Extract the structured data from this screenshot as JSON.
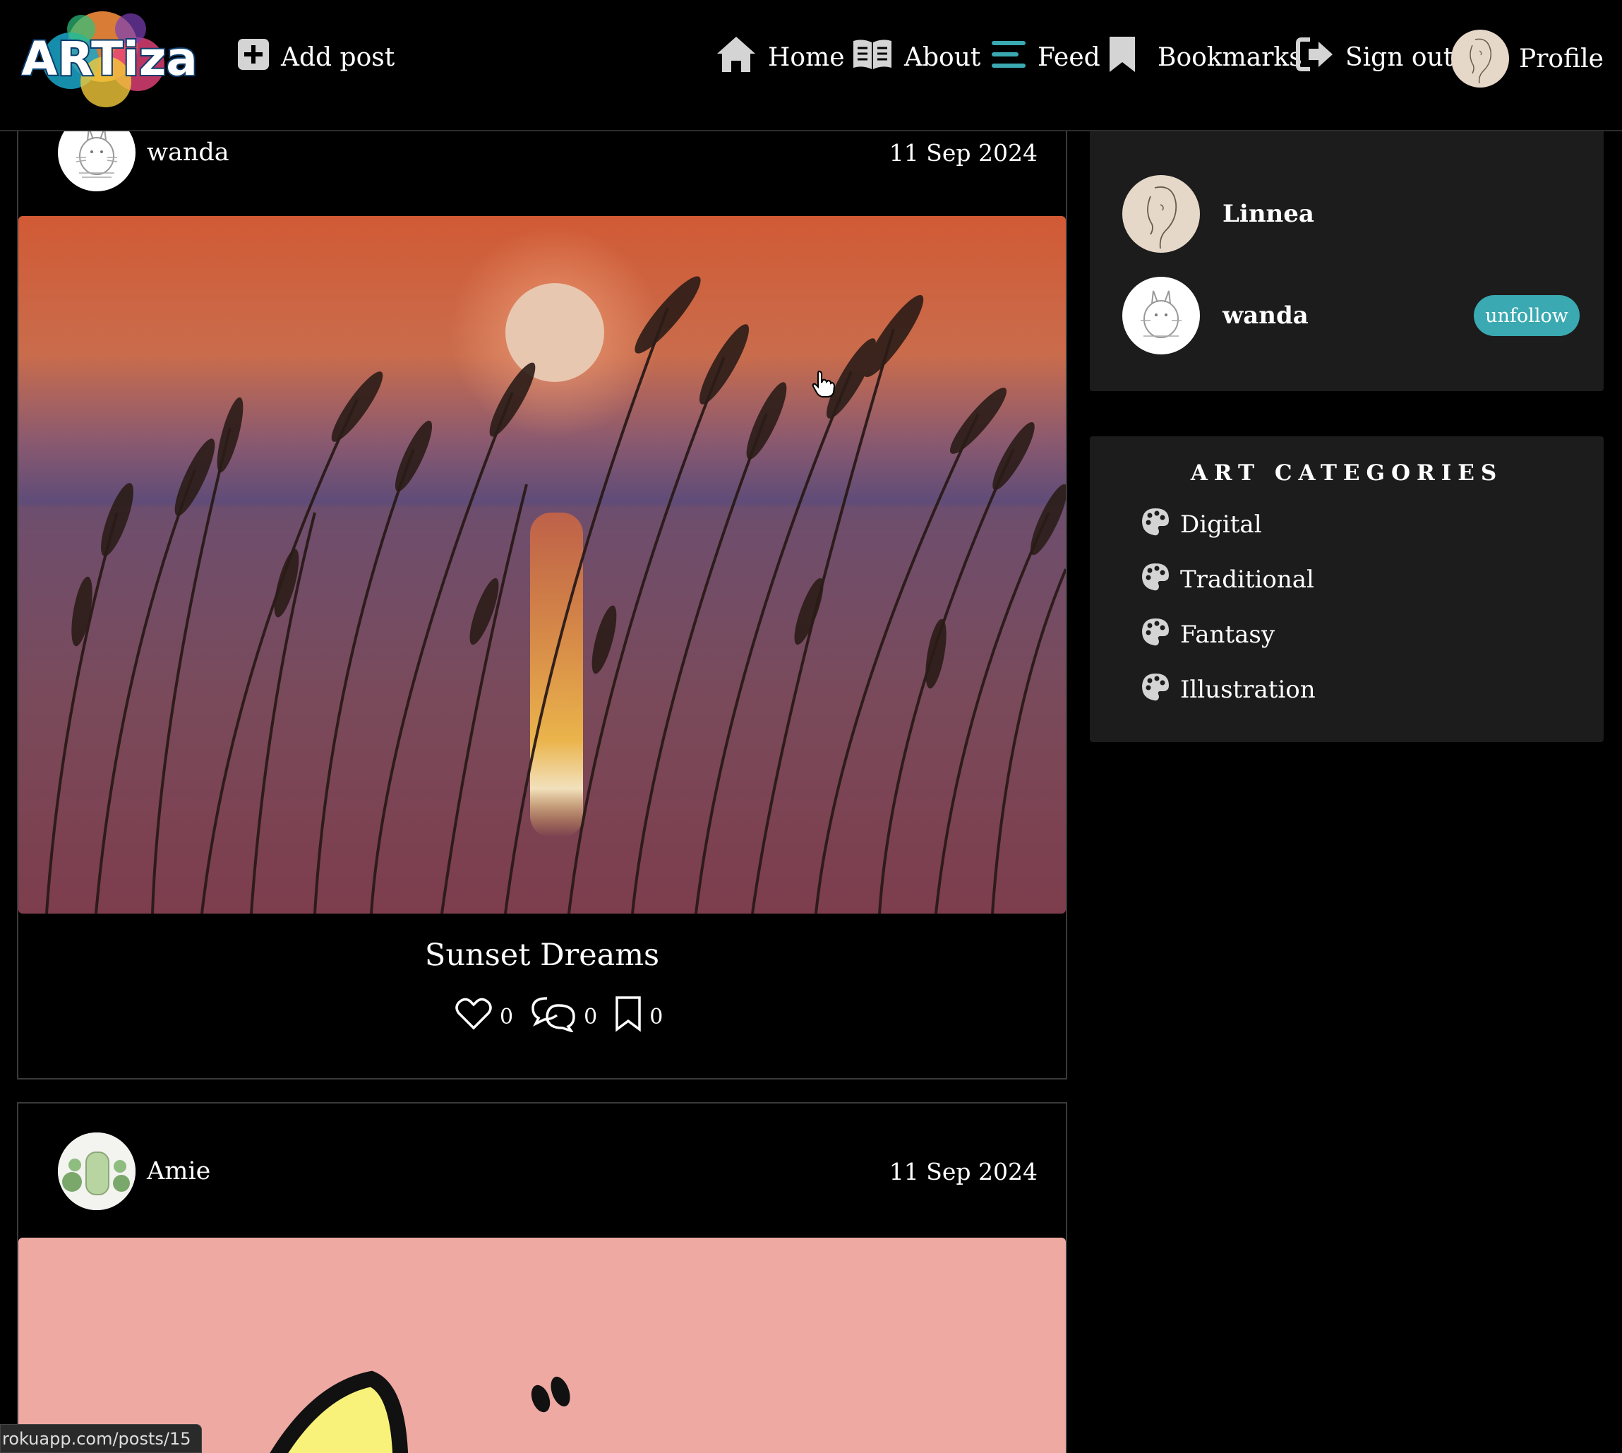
{
  "app": {
    "logo_text": "ARTiza"
  },
  "nav": {
    "add_post": "Add post",
    "home": "Home",
    "about": "About",
    "feed": "Feed",
    "bookmarks": "Bookmarks",
    "sign_out": "Sign out",
    "profile": "Profile",
    "accent_color": "#3aa9b1"
  },
  "posts": [
    {
      "author": "wanda",
      "date": "11 Sep 2024",
      "title": "Sunset Dreams",
      "likes": "0",
      "comments": "0",
      "bookmarks": "0"
    },
    {
      "author": "Amie",
      "date": "11 Sep 2024"
    }
  ],
  "following": [
    {
      "name": "Linnea"
    },
    {
      "name": "wanda",
      "action": "unfollow"
    }
  ],
  "categories": {
    "title": "ART CATEGORIES",
    "items": [
      "Digital",
      "Traditional",
      "Fantasy",
      "Illustration"
    ]
  },
  "status_bar": {
    "url": "rokuapp.com/posts/15"
  }
}
